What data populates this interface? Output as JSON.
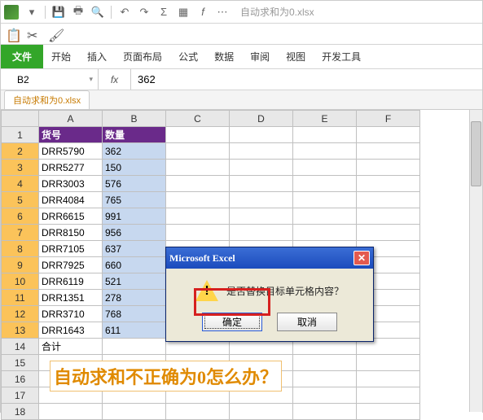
{
  "window": {
    "filename": "自动求和为0.xlsx"
  },
  "ribbon": {
    "file": "文件",
    "tabs": [
      "开始",
      "插入",
      "页面布局",
      "公式",
      "数据",
      "审阅",
      "视图",
      "开发工具"
    ]
  },
  "formula_bar": {
    "name": "B2",
    "fx": "fx",
    "value": "362"
  },
  "workbook_tab": "自动求和为0.xlsx",
  "columns": [
    "A",
    "B",
    "C",
    "D",
    "E",
    "F"
  ],
  "headers": {
    "A": "货号",
    "B": "数量"
  },
  "rows": [
    {
      "n": 1
    },
    {
      "n": 2,
      "A": "DRR5790",
      "B": "362"
    },
    {
      "n": 3,
      "A": "DRR5277",
      "B": "150"
    },
    {
      "n": 4,
      "A": "DRR3003",
      "B": "576"
    },
    {
      "n": 5,
      "A": "DRR4084",
      "B": "765"
    },
    {
      "n": 6,
      "A": "DRR6615",
      "B": "991"
    },
    {
      "n": 7,
      "A": "DRR8150",
      "B": "956"
    },
    {
      "n": 8,
      "A": "DRR7105",
      "B": "637"
    },
    {
      "n": 9,
      "A": "DRR7925",
      "B": "660"
    },
    {
      "n": 10,
      "A": "DRR6119",
      "B": "521"
    },
    {
      "n": 11,
      "A": "DRR1351",
      "B": "278"
    },
    {
      "n": 12,
      "A": "DRR3710",
      "B": "768"
    },
    {
      "n": 13,
      "A": "DRR1643",
      "B": "611"
    },
    {
      "n": 14,
      "A": "合计",
      "B": ""
    },
    {
      "n": 15
    },
    {
      "n": 16
    },
    {
      "n": 17
    },
    {
      "n": 18
    }
  ],
  "dialog": {
    "title": "Microsoft Excel",
    "message": "是否替换目标单元格内容？",
    "ok": "确定",
    "cancel": "取消"
  },
  "annotation": "自动求和不正确为0怎么办？"
}
